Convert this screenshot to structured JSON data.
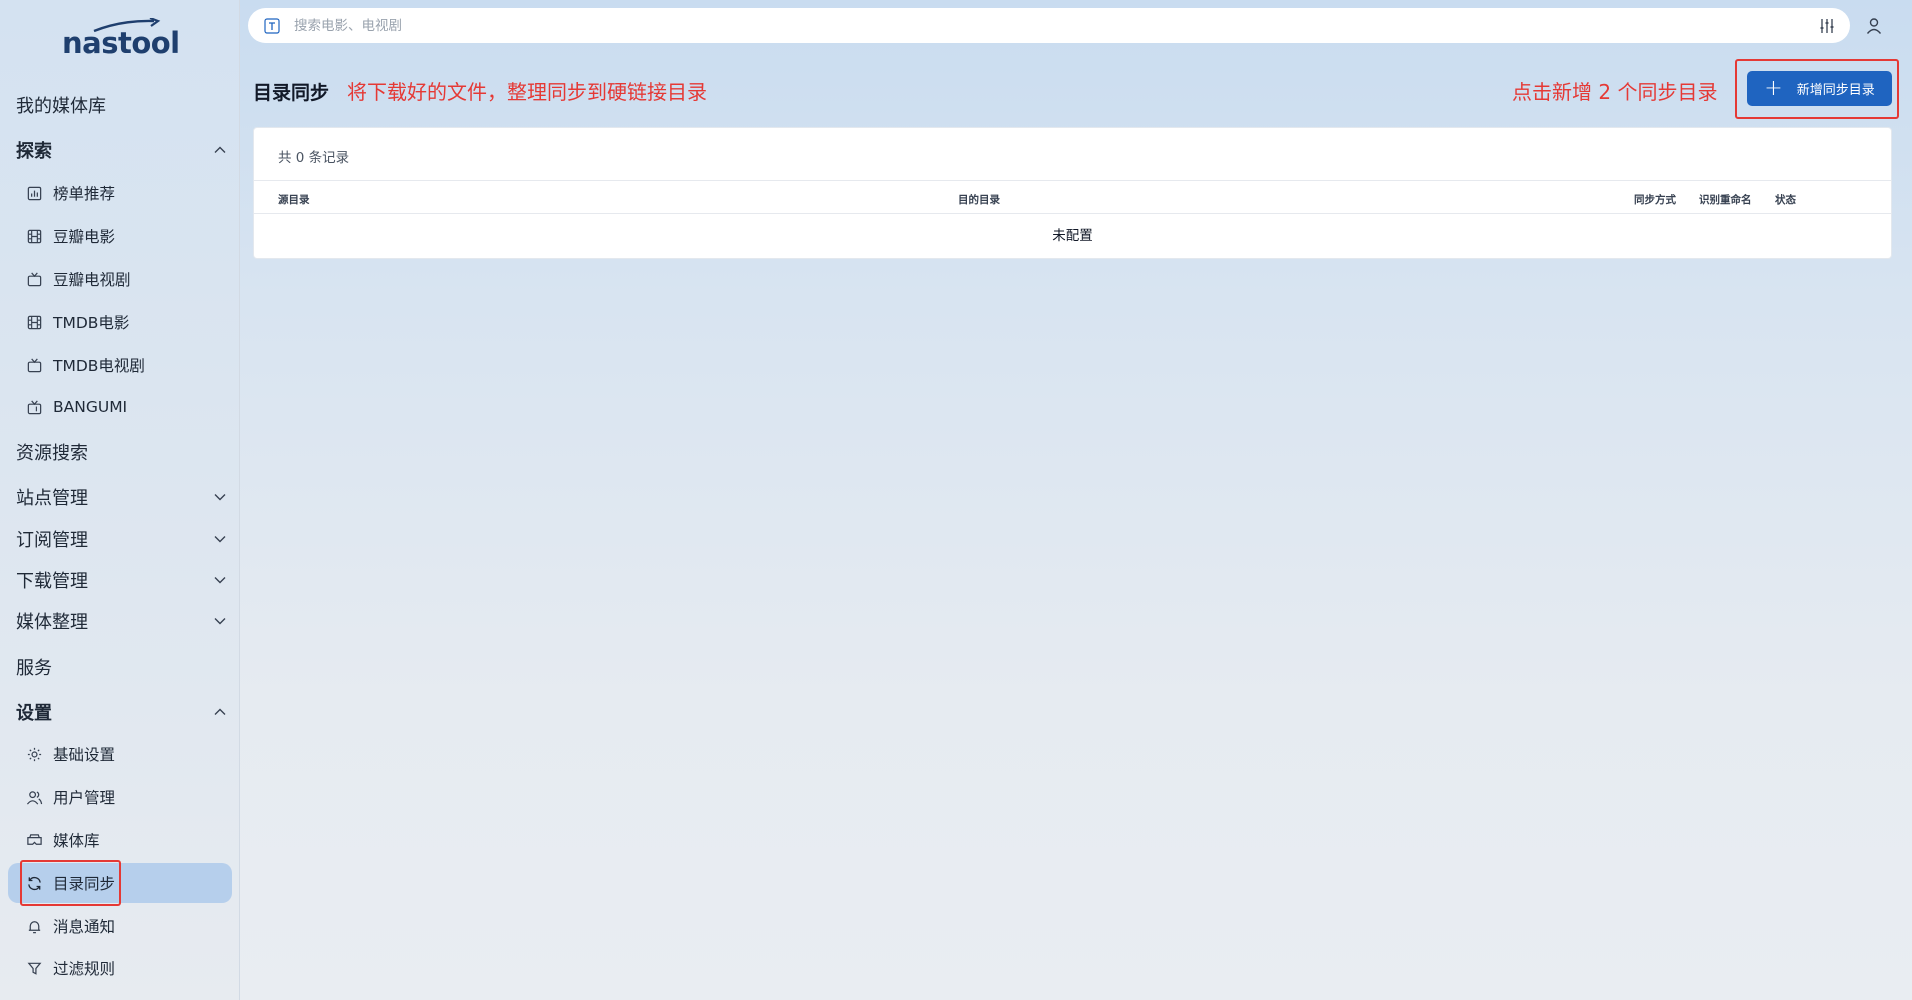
{
  "app": {
    "logo_text": "nastool"
  },
  "search": {
    "placeholder": "搜索电影、电视剧"
  },
  "sidebar": {
    "my_library": "我的媒体库",
    "explore": {
      "label": "探索",
      "items": [
        "榜单推荐",
        "豆瓣电影",
        "豆瓣电视剧",
        "TMDB电影",
        "TMDB电视剧",
        "BANGUMI"
      ]
    },
    "resource_search": "资源搜索",
    "site_management": "站点管理",
    "subscription_management": "订阅管理",
    "download_management": "下载管理",
    "media_organize": "媒体整理",
    "services": "服务",
    "settings": {
      "label": "设置",
      "items": [
        "基础设置",
        "用户管理",
        "媒体库",
        "目录同步",
        "消息通知",
        "过滤规则"
      ]
    }
  },
  "header": {
    "title": "目录同步",
    "note": "将下载好的文件，整理同步到硬链接目录",
    "right_note": "点击新增 2 个同步目录",
    "add_button": "新增同步目录"
  },
  "table": {
    "count_text": "共 0 条记录",
    "columns": [
      "源目录",
      "目的目录",
      "同步方式",
      "识别重命名",
      "状态"
    ],
    "empty_text": "未配置"
  },
  "colors": {
    "accent": "#1f64c0",
    "annotation": "#e53935",
    "active_nav": "#b6cfec"
  }
}
